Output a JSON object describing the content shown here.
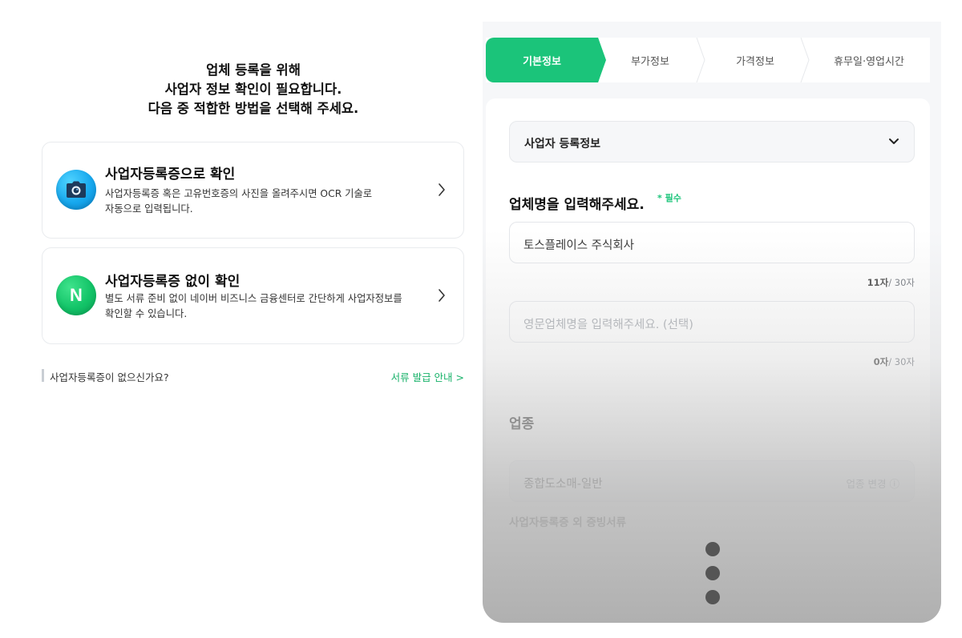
{
  "intro": {
    "line1": "업체 등록을 위해",
    "line2": "사업자 정보 확인이 필요합니다.",
    "line3": "다음 중 적합한 방법을 선택해 주세요."
  },
  "options": [
    {
      "title": "사업자등록증으로 확인",
      "desc_line1": "사업자등록증 혹은 고유번호증의 사진을 올려주시면 OCR 기술로",
      "desc_line2": "자동으로 입력됩니다.",
      "icon": "camera-icon"
    },
    {
      "title": "사업자등록증 없이 확인",
      "desc_line1": "별도 서류 준비 없이 네이버 비즈니스 금융센터로 간단하게 사업자정보를",
      "desc_line2": "확인할 수 있습니다.",
      "icon": "naver-n-icon",
      "icon_letter": "N"
    }
  ],
  "help": {
    "question": "사업자등록증이 없으신가요?",
    "link": "서류 발급 안내 >"
  },
  "steps": [
    "기본정보",
    "부가정보",
    "가격정보",
    "휴무일·영업시간"
  ],
  "active_step": 0,
  "form": {
    "section_select": "사업자 등록정보",
    "name_question": "업체명을 입력해주세요.",
    "required": "* 필수",
    "name_value": "토스플레이스 주식회사",
    "name_count": "11자",
    "name_max": "/ 30자",
    "english_placeholder": "영문업체명을 입력해주세요. (선택)",
    "english_count": "0자",
    "english_max": "/ 30자",
    "industry_title": "업종",
    "industry_value": "종합도소매-일반",
    "industry_change": "업종 변경 ⓘ",
    "docs_title": "사업자등록증 외 증빙서류"
  },
  "colors": {
    "accent": "#1bc47a",
    "camera_blue": "#17a8ee",
    "naver_green": "#13c468"
  }
}
